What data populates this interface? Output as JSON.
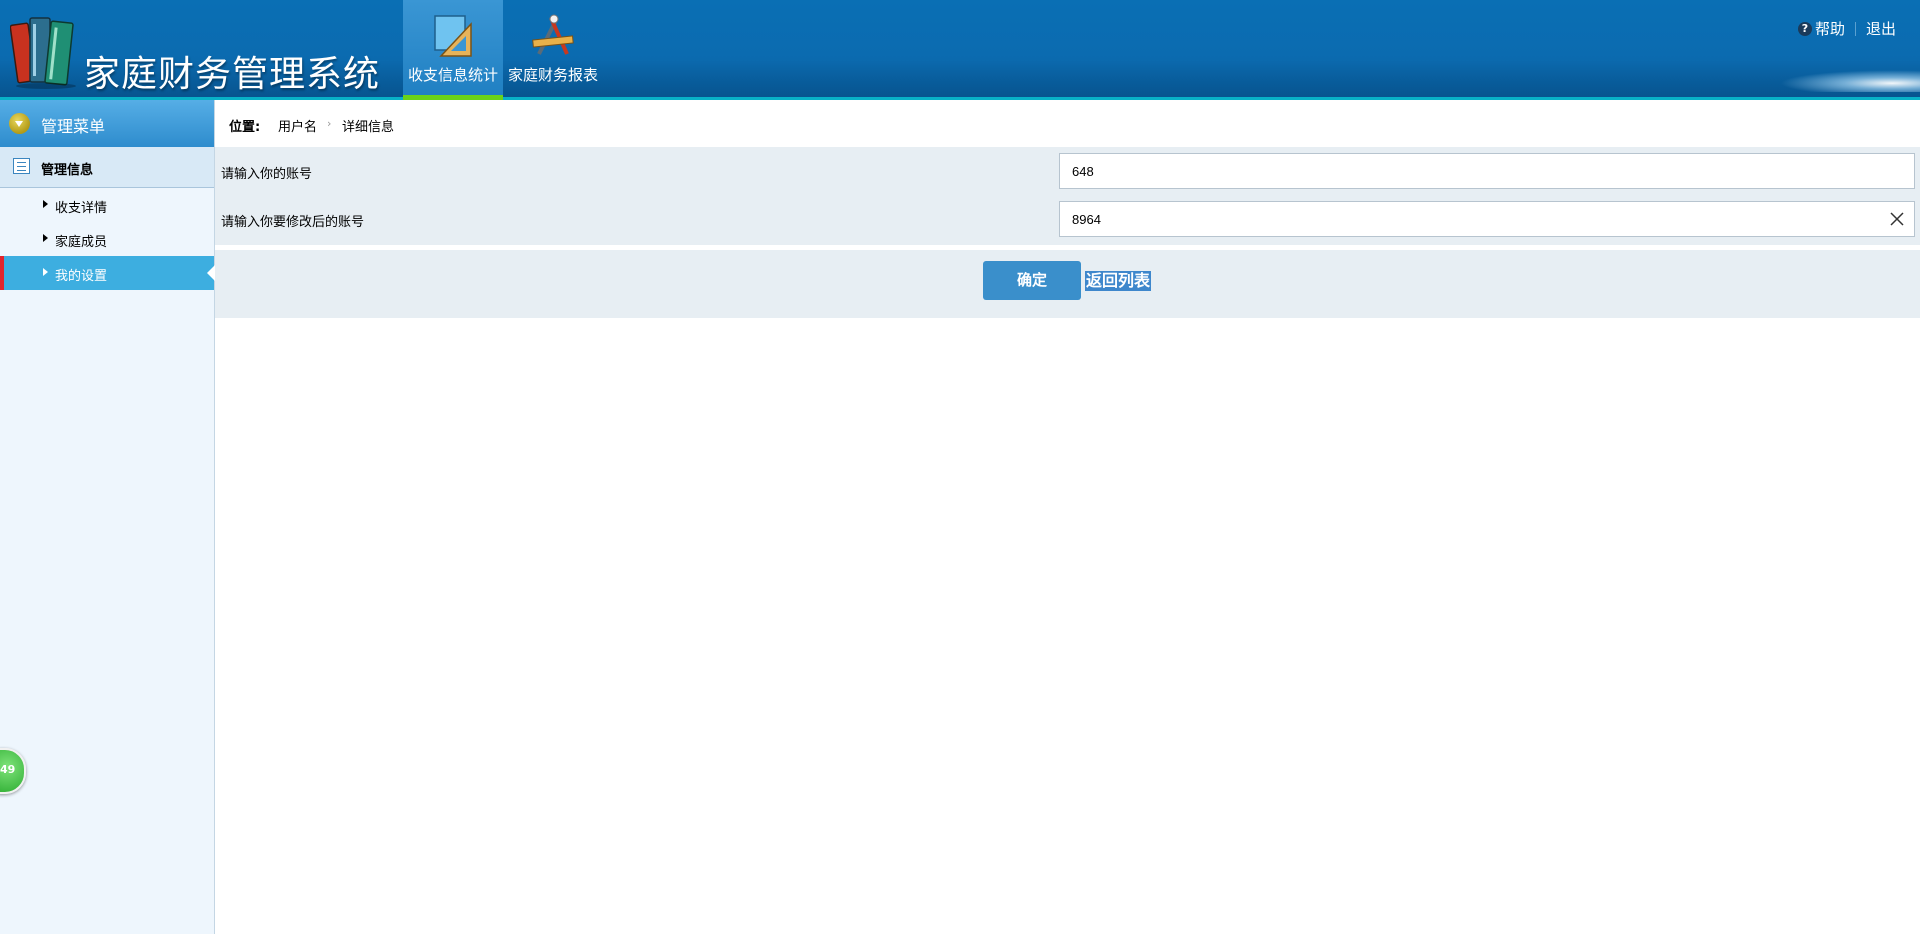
{
  "app": {
    "title": "家庭财务管理系统"
  },
  "top_nav": [
    {
      "label": "收支信息统计",
      "icon": "ruler-triangle-icon",
      "active": true
    },
    {
      "label": "家庭财务报表",
      "icon": "drafting-tools-icon",
      "active": false
    }
  ],
  "top_links": {
    "help_icon": "?",
    "help": "帮助",
    "logout": "退出"
  },
  "sidebar": {
    "header": "管理菜单",
    "group": "管理信息",
    "items": [
      {
        "label": "收支详情",
        "active": false
      },
      {
        "label": "家庭成员",
        "active": false
      },
      {
        "label": "我的设置",
        "active": true
      }
    ]
  },
  "floating_badge": "49",
  "breadcrumb": {
    "prefix": "位置:",
    "items": [
      "用户名",
      "详细信息"
    ]
  },
  "form": {
    "fields": [
      {
        "label": "请输入你的账号",
        "value": "648"
      },
      {
        "label": "请输入你要修改后的账号",
        "value": "8964"
      }
    ],
    "confirm_label": "确定",
    "back_label": "返回列表"
  },
  "colors": {
    "header_blue": "#0a6fb4",
    "active_nav_underline": "#6ad21a",
    "sidebar_active": "#3daee0",
    "sidebar_active_marker": "#e2242c",
    "confirm_button": "#3a8fcb"
  }
}
